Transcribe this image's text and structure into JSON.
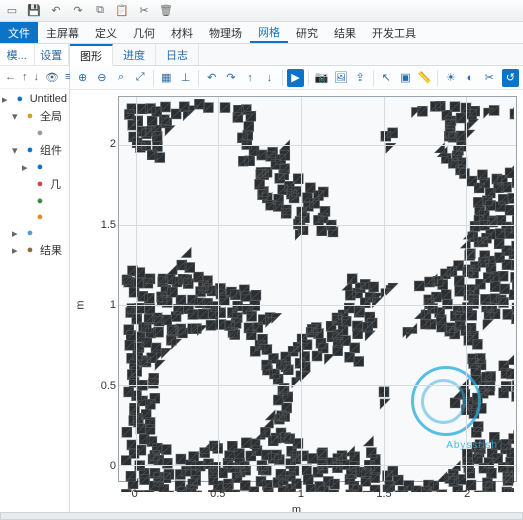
{
  "titlebar_icons": [
    "file-icon",
    "save-icon",
    "undo-icon",
    "redo-icon",
    "copy-icon",
    "paste-icon",
    "cut-icon",
    "delete-icon"
  ],
  "menu": {
    "file": "文件",
    "items": [
      "主屏幕",
      "定义",
      "几何",
      "材料",
      "物理场",
      "网格",
      "研究",
      "结果",
      "开发工具"
    ],
    "active": "网格"
  },
  "sidebar": {
    "tabs": [
      "模...",
      "设置"
    ],
    "toolbar": [
      "nav-left",
      "nav-up",
      "nav-down",
      "eye",
      "collapse"
    ],
    "tree": [
      {
        "indent": 0,
        "arrow": "▸",
        "icon": "doc",
        "color": "#0b74c8",
        "label": "Untitled"
      },
      {
        "indent": 1,
        "arrow": "▾",
        "icon": "globe",
        "color": "#c9a227",
        "label": "全局"
      },
      {
        "indent": 2,
        "arrow": "",
        "icon": "dot",
        "color": "#999",
        "label": ""
      },
      {
        "indent": 1,
        "arrow": "▾",
        "icon": "cube",
        "color": "#0b74c8",
        "label": "组件"
      },
      {
        "indent": 2,
        "arrow": "▸",
        "icon": "def",
        "color": "#0b74c8",
        "label": ""
      },
      {
        "indent": 2,
        "arrow": "",
        "icon": "geom",
        "color": "#d24444",
        "label": "几"
      },
      {
        "indent": 2,
        "arrow": "",
        "icon": "mat",
        "color": "#3a8a3a",
        "label": ""
      },
      {
        "indent": 2,
        "arrow": "",
        "icon": "mesh",
        "color": "#e58b1e",
        "label": ""
      },
      {
        "indent": 1,
        "arrow": "▸",
        "icon": "study",
        "color": "#5a9bcf",
        "label": ""
      },
      {
        "indent": 1,
        "arrow": "▸",
        "icon": "res",
        "color": "#8c6b3a",
        "label": "结果"
      }
    ]
  },
  "content": {
    "tabs": [
      "图形",
      "进度",
      "日志"
    ],
    "active": "图形",
    "toolbar": [
      "zoom-in",
      "zoom-out",
      "zoom-sel",
      "zoom-fit",
      "grid",
      "axes",
      "rot-l",
      "rot-r",
      "rot-u",
      "rot-d",
      "view-reset",
      "camera",
      "image",
      "export",
      "select",
      "select-box",
      "measure",
      "light",
      "render",
      "clip",
      "reset"
    ]
  },
  "chart_data": {
    "type": "mesh-plot",
    "title": "",
    "xlabel": "m",
    "ylabel": "m",
    "xlim": [
      -0.1,
      2.3
    ],
    "ylim": [
      -0.1,
      2.3
    ],
    "xticks": [
      0,
      0.5,
      1,
      1.5,
      2
    ],
    "yticks": [
      0,
      0.5,
      1,
      1.5,
      2
    ],
    "description": "2D finite-element triangular mesh over a porous / random-void geometry filling [0,2]×[0,2]"
  },
  "watermark": "Abyssfish"
}
